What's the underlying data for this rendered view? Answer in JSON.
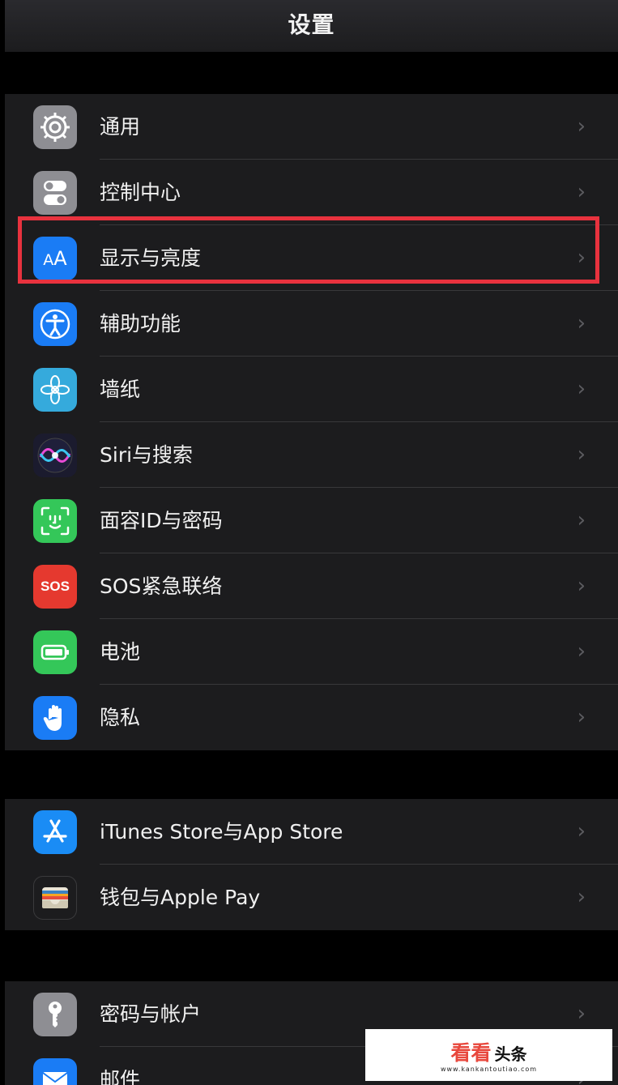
{
  "nav": {
    "title": "设置"
  },
  "groups": [
    {
      "items": [
        {
          "label": "通用",
          "icon": "gear-icon",
          "color": "#8e8e93"
        },
        {
          "label": "控制中心",
          "icon": "toggles-icon",
          "color": "#8e8e93"
        },
        {
          "label": "显示与亮度",
          "icon": "text-size-icon",
          "color": "#1a7cf5"
        },
        {
          "label": "辅助功能",
          "icon": "accessibility-icon",
          "color": "#1a7cf5"
        },
        {
          "label": "墙纸",
          "icon": "flower-icon",
          "color": "#35aadc"
        },
        {
          "label": "Siri与搜索",
          "icon": "siri-icon",
          "color": "#1b1b2e"
        },
        {
          "label": "面容ID与密码",
          "icon": "face-id-icon",
          "color": "#34c759"
        },
        {
          "label": "SOS紧急联络",
          "icon": "sos-icon",
          "color": "#e5392f",
          "icon_text": "SOS"
        },
        {
          "label": "电池",
          "icon": "battery-icon",
          "color": "#34c759"
        },
        {
          "label": "隐私",
          "icon": "hand-icon",
          "color": "#1a7cf5"
        }
      ]
    },
    {
      "items": [
        {
          "label": "iTunes Store与App Store",
          "icon": "app-store-icon",
          "color": "#1a8cf5"
        },
        {
          "label": "钱包与Apple Pay",
          "icon": "wallet-icon",
          "color": "#1c1c1e"
        }
      ]
    },
    {
      "items": [
        {
          "label": "密码与帐户",
          "icon": "key-icon",
          "color": "#8e8e93"
        },
        {
          "label": "邮件",
          "icon": "mail-icon",
          "color": "#1a7cf5"
        }
      ]
    }
  ],
  "chevron": "›",
  "highlight": {
    "color": "#e8323e"
  },
  "watermark": {
    "brand": "看看",
    "brand2": "头条",
    "url": "www.kankantoutiao.com"
  }
}
